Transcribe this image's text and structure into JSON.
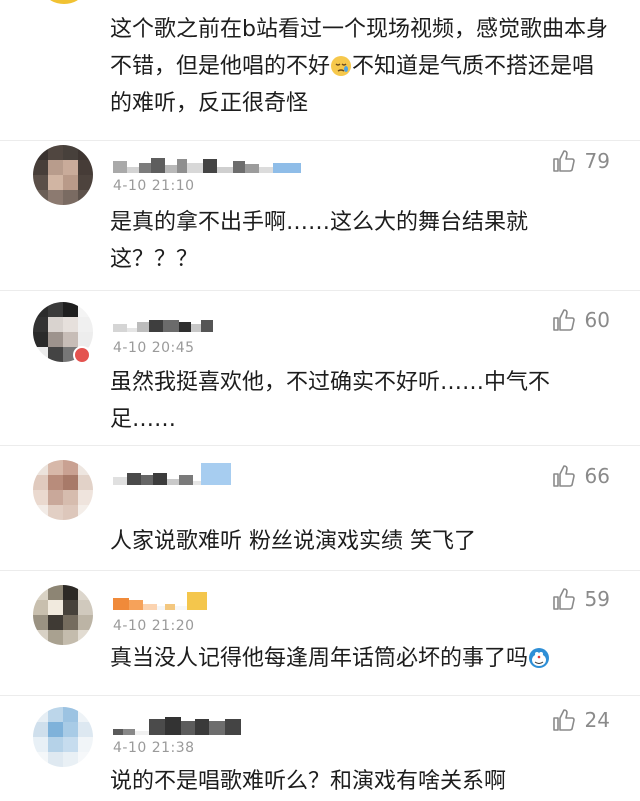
{
  "comments": [
    {
      "text": "这个歌之前在b站看过一个现场视频，感觉歌曲本身不错，但是他唱的不好",
      "text_after": "不知道是气质不搭还是唱的难听，反正很奇怪",
      "emoji": "crying-face"
    },
    {
      "likes": "79",
      "time": "4-10 21:10",
      "text": "是真的拿不出手啊……这么大的舞台结果就这？？？"
    },
    {
      "likes": "60",
      "time": "4-10 20:45",
      "text": "虽然我挺喜欢他，不过确实不好听……中气不足……"
    },
    {
      "likes": "66",
      "text": "人家说歌难听 粉丝说演戏实绩 笑飞了"
    },
    {
      "likes": "59",
      "time": "4-10 21:20",
      "text": "真当没人记得他每逢周年话筒必坏的事了吗",
      "emoji": "doraemon"
    },
    {
      "likes": "24",
      "time": "4-10 21:38",
      "text": "说的不是唱歌难听么？和演戏有啥关系啊"
    }
  ],
  "icons": {
    "like": "thumbs-up-icon"
  },
  "colors": {
    "like_gray": "#8a8a8a",
    "time_gray": "#9a9a9a",
    "divider": "#ececec"
  }
}
